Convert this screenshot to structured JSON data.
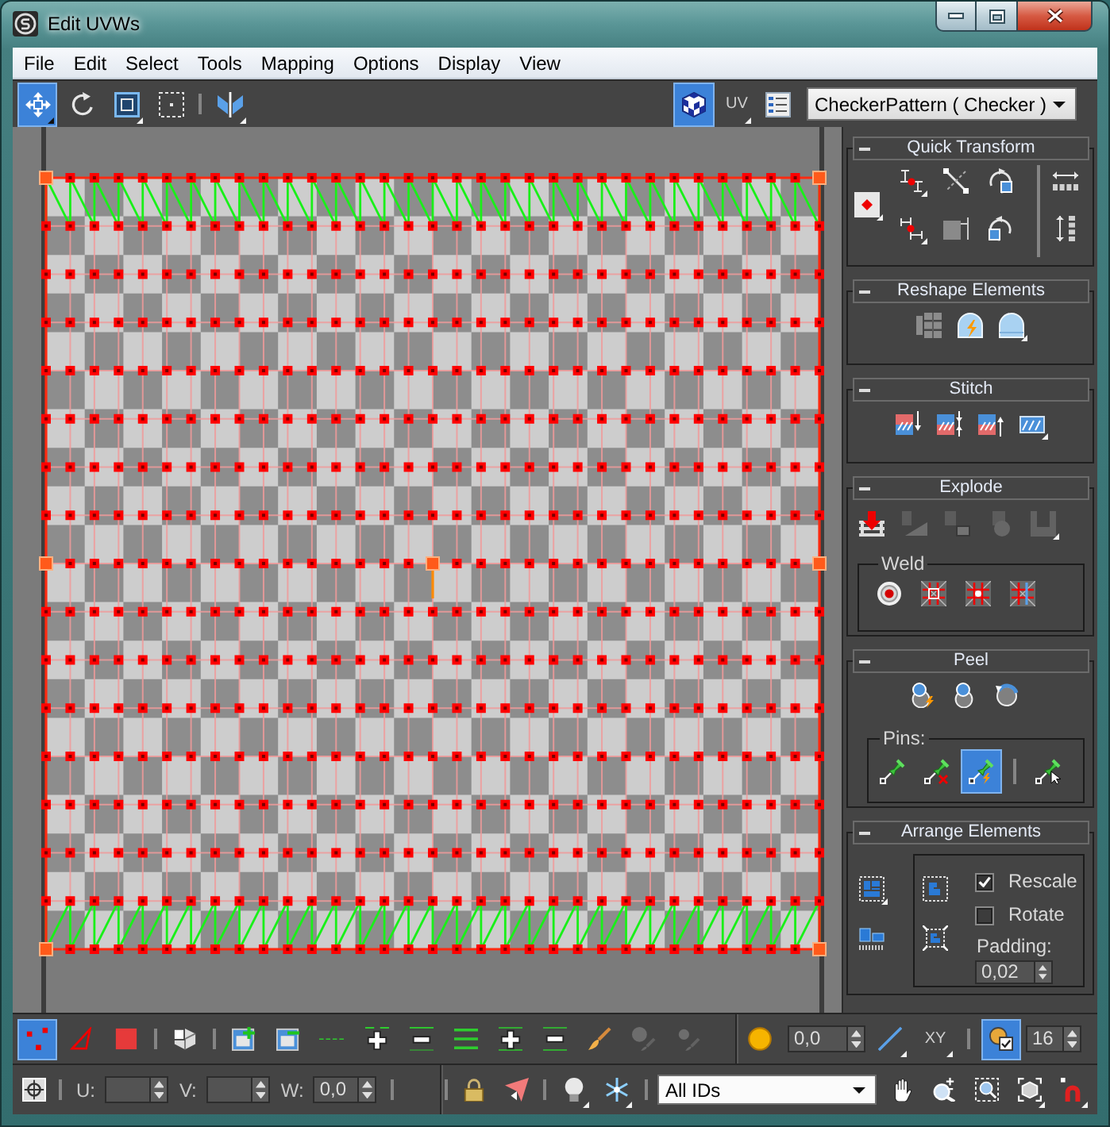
{
  "window": {
    "title": "Edit UVWs",
    "controls": [
      {
        "kind": "minimize"
      },
      {
        "kind": "maximize"
      },
      {
        "kind": "close"
      }
    ]
  },
  "menu": [
    "File",
    "Edit",
    "Select",
    "Tools",
    "Mapping",
    "Options",
    "Display",
    "View"
  ],
  "top_toolbar": {
    "left": [
      [
        {
          "kind": "move",
          "selected": true,
          "flyout": true
        },
        {
          "kind": "rotate",
          "selected": false,
          "flyout": false
        },
        {
          "kind": "scale",
          "selected": false,
          "flyout": true
        },
        {
          "kind": "freeform",
          "selected": false,
          "flyout": false
        }
      ],
      [
        {
          "kind": "mirror",
          "selected": false,
          "flyout": true
        }
      ]
    ],
    "right": [
      {
        "kind": "checker",
        "selected": true,
        "flyout": false
      },
      {
        "kind": "uv_toggle",
        "label": "UV",
        "selected": false,
        "flyout": true
      },
      {
        "kind": "list",
        "selected": false,
        "flyout": false
      }
    ],
    "texture_dropdown": {
      "value": "CheckerPattern ( Checker )"
    }
  },
  "side_panel": {
    "rollouts": [
      {
        "kind": "quick_transform",
        "title": "Quick Transform",
        "expanded": true,
        "columns": [
          [
            {
              "kind": "pivot",
              "flyout": true
            }
          ],
          [
            {
              "kind": "align_h",
              "flyout": true
            },
            {
              "kind": "align_v",
              "flyout": true
            }
          ],
          [
            {
              "kind": "straighten",
              "flyout": false
            },
            {
              "kind": "align_edge",
              "flyout": false
            }
          ],
          [
            {
              "kind": "rotate_cw",
              "flyout": false
            },
            {
              "kind": "rotate_ccw",
              "flyout": false
            }
          ],
          [
            {
              "kind": "space_h",
              "flyout": false
            },
            {
              "kind": "space_v",
              "flyout": false
            }
          ]
        ]
      },
      {
        "kind": "row",
        "title": "Reshape Elements",
        "expanded": true,
        "buttons": [
          {
            "kind": "straighten_grid",
            "flyout": false
          },
          {
            "kind": "relax_bolt",
            "flyout": false
          },
          {
            "kind": "relax",
            "flyout": true
          }
        ]
      },
      {
        "kind": "row",
        "title": "Stitch",
        "expanded": true,
        "buttons": [
          {
            "kind": "stitch_source",
            "flyout": false
          },
          {
            "kind": "stitch_average",
            "flyout": false
          },
          {
            "kind": "stitch_target",
            "flyout": false
          },
          {
            "kind": "stitch_custom",
            "flyout": true
          }
        ]
      },
      {
        "kind": "explode",
        "title": "Explode",
        "expanded": true,
        "buttons": [
          {
            "kind": "break",
            "disabled": false,
            "flyout": false
          },
          {
            "kind": "detach_angle",
            "disabled": true,
            "flyout": false
          },
          {
            "kind": "detach_groups",
            "disabled": true,
            "flyout": false
          },
          {
            "kind": "detach_sphere",
            "disabled": true,
            "flyout": false
          },
          {
            "kind": "detach_flatten",
            "disabled": true,
            "flyout": true
          }
        ],
        "group": {
          "label": "Weld",
          "buttons": [
            {
              "kind": "target"
            },
            {
              "kind": "weld_selected"
            },
            {
              "kind": "weld_all"
            },
            {
              "kind": "weld_custom"
            }
          ]
        }
      },
      {
        "kind": "peel",
        "title": "Peel",
        "expanded": true,
        "buttons": [
          {
            "kind": "quick_peel"
          },
          {
            "kind": "peel_mode"
          },
          {
            "kind": "reset_peel"
          }
        ],
        "group": {
          "label": "Pins:",
          "groups": [
            [
              {
                "kind": "pin",
                "selected": false
              },
              {
                "kind": "unpin",
                "selected": false
              },
              {
                "kind": "auto_pin",
                "selected": true
              }
            ],
            [
              {
                "kind": "select_pins",
                "selected": false
              }
            ]
          ]
        }
      },
      {
        "kind": "arrange",
        "title": "Arrange Elements",
        "expanded": true,
        "buttons": [
          {
            "kind": "pack_custom",
            "flyout": true
          },
          {
            "kind": "pack_together",
            "flyout": false
          }
        ],
        "group": {
          "buttons": [
            {
              "kind": "pack_normalize"
            },
            {
              "kind": "pack_rescale"
            }
          ],
          "options": [
            {
              "label": "Rescale",
              "checked": true
            },
            {
              "label": "Rotate",
              "checked": false
            }
          ],
          "padding": {
            "label": "Padding:",
            "value": "0,02"
          }
        }
      }
    ]
  },
  "bottom_toolbar": {
    "modes": [
      [
        {
          "kind": "vertex",
          "selected": true
        },
        {
          "kind": "edge",
          "selected": false
        },
        {
          "kind": "polygon",
          "selected": false
        }
      ],
      [
        {
          "kind": "element",
          "selected": false
        }
      ]
    ],
    "select_tools": [
      {
        "kind": "grow",
        "disabled": false
      },
      {
        "kind": "shrink",
        "disabled": false
      },
      {
        "kind": "loop",
        "disabled": false
      },
      {
        "kind": "loop_grow",
        "disabled": false
      },
      {
        "kind": "loop_shrink",
        "disabled": false
      },
      {
        "kind": "ring",
        "disabled": false
      },
      {
        "kind": "ring_grow",
        "disabled": false
      },
      {
        "kind": "ring_shrink",
        "disabled": false
      },
      {
        "kind": "paint",
        "disabled": false
      },
      {
        "kind": "paint_grow",
        "disabled": true
      },
      {
        "kind": "paint_shrink",
        "disabled": true
      }
    ],
    "soft_selection": {
      "toggle": {
        "kind": "sun",
        "selected": false
      },
      "falloff": {
        "value": "0,0"
      },
      "tools": [
        {
          "kind": "line",
          "flyout": true
        },
        {
          "kind": "axis_toggle",
          "label": "XY",
          "flyout": true
        }
      ],
      "settings": {
        "kind": "settings",
        "selected": true
      },
      "size": {
        "value": "16"
      }
    },
    "snap": {
      "kind": "snap"
    },
    "coords": [
      {
        "label": "U:"
      },
      {
        "label": "V:"
      },
      {
        "label": "W:",
        "value": "0,0"
      }
    ],
    "display_tools": [
      [
        {
          "kind": "lock",
          "flyout": false
        },
        {
          "kind": "paint_pin",
          "flyout": false
        }
      ],
      [
        {
          "kind": "bulb",
          "flyout": true
        },
        {
          "kind": "freeze",
          "flyout": true
        }
      ]
    ],
    "id_filter": {
      "value": "All IDs"
    },
    "view_tools": [
      {
        "kind": "pan",
        "flyout": false
      },
      {
        "kind": "zoom",
        "flyout": false
      },
      {
        "kind": "zoom_region",
        "flyout": false
      },
      {
        "kind": "zoom_extents",
        "flyout": true
      },
      {
        "kind": "magnet",
        "flyout": true
      }
    ]
  }
}
